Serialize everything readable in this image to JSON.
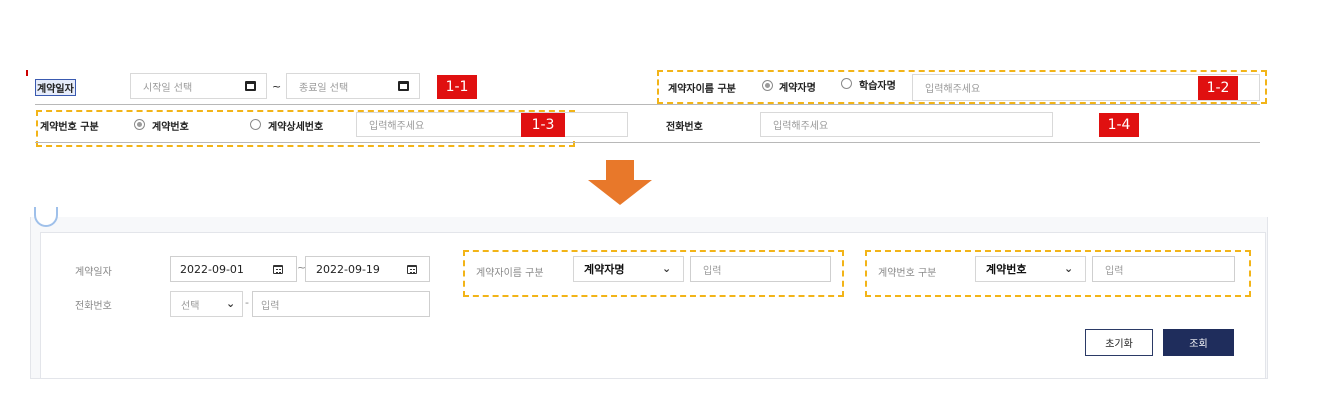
{
  "top": {
    "contract_date_label": "계약일자",
    "start_date_placeholder": "시작일 선택",
    "range_separator": "~",
    "end_date_placeholder": "종료일 선택",
    "badge_1_1": "1-1",
    "name_type_label": "계약자이름 구분",
    "radio_contractor_name": "계약자명",
    "radio_learner_name": "학습자명",
    "name_input_placeholder": "입력해주세요",
    "badge_1_2": "1-2",
    "contract_no_type_label": "계약번호 구분",
    "radio_contract_no": "계약번호",
    "radio_detail_contract_no": "계약상세번호",
    "contract_no_input_placeholder": "입력해주세요",
    "badge_1_3": "1-3",
    "phone_label": "전화번호",
    "phone_input_placeholder": "입력해주세요",
    "badge_1_4": "1-4"
  },
  "bottom": {
    "contract_date_label": "계약일자",
    "start_date_value": "2022-09-01",
    "range_separator": "~",
    "end_date_value": "2022-09-19",
    "phone_label": "전화번호",
    "phone_select_value": "선택",
    "phone_separator": "-",
    "phone_input_placeholder": "입력",
    "name_type_label": "계약자이름 구분",
    "name_type_select_value": "계약자명",
    "name_input_placeholder": "입력",
    "contract_no_type_label": "계약번호 구분",
    "contract_no_select_value": "계약번호",
    "contract_no_input_placeholder": "입력",
    "reset_button": "초기화",
    "search_button": "조회"
  },
  "colors": {
    "badge_red": "#e01010",
    "dash_yellow": "#f2b418",
    "arrow_orange": "#e8782a",
    "search_button_navy": "#1f2d5c"
  },
  "icons": [
    "calendar-icon",
    "chevron-down-icon",
    "radio-icon",
    "arrow-down-icon"
  ]
}
